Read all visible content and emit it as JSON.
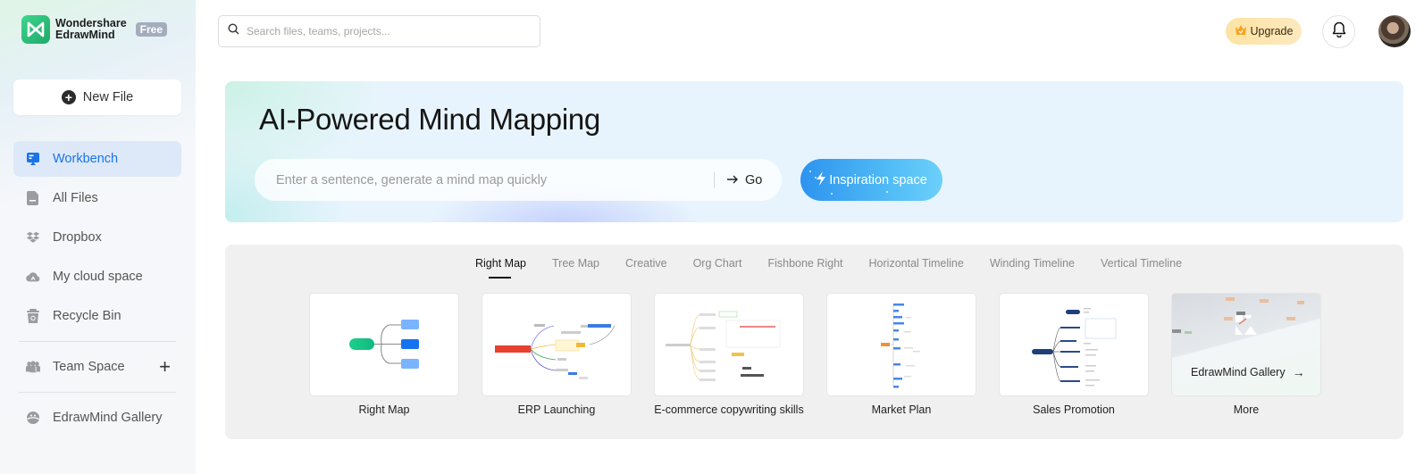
{
  "brand": {
    "name_line1": "Wondershare",
    "name_line2": "EdrawMind",
    "badge": "Free",
    "logo_color": "#2bc07b"
  },
  "sidebar": {
    "new_file_label": "New File",
    "items": [
      {
        "label": "Workbench",
        "icon": "workbench-icon",
        "active": true
      },
      {
        "label": "All Files",
        "icon": "file-icon",
        "active": false
      },
      {
        "label": "Dropbox",
        "icon": "dropbox-icon",
        "active": false
      },
      {
        "label": "My cloud space",
        "icon": "cloud-icon",
        "active": false
      },
      {
        "label": "Recycle Bin",
        "icon": "trash-icon",
        "active": false
      }
    ],
    "team_space_label": "Team Space",
    "gallery_label": "EdrawMind Gallery",
    "active_color": "#1a73e8"
  },
  "header": {
    "search_placeholder": "Search files, teams, projects...",
    "upgrade_label": "Upgrade"
  },
  "hero": {
    "title": "AI-Powered Mind Mapping",
    "input_placeholder": "Enter a sentence, generate a mind map quickly",
    "go_label": "Go",
    "inspiration_label": "Inspiration space"
  },
  "templates": {
    "tabs": [
      {
        "label": "Right Map",
        "active": true
      },
      {
        "label": "Tree Map",
        "active": false
      },
      {
        "label": "Creative",
        "active": false
      },
      {
        "label": "Org Chart",
        "active": false
      },
      {
        "label": "Fishbone Right",
        "active": false
      },
      {
        "label": "Horizontal Timeline",
        "active": false
      },
      {
        "label": "Winding Timeline",
        "active": false
      },
      {
        "label": "Vertical Timeline",
        "active": false
      }
    ],
    "cards": [
      {
        "label": "Right Map"
      },
      {
        "label": "ERP Launching"
      },
      {
        "label": "E-commerce copywriting skills"
      },
      {
        "label": "Market Plan"
      },
      {
        "label": "Sales Promotion"
      },
      {
        "label": "More"
      }
    ],
    "gallery_cta": "EdrawMind Gallery"
  }
}
